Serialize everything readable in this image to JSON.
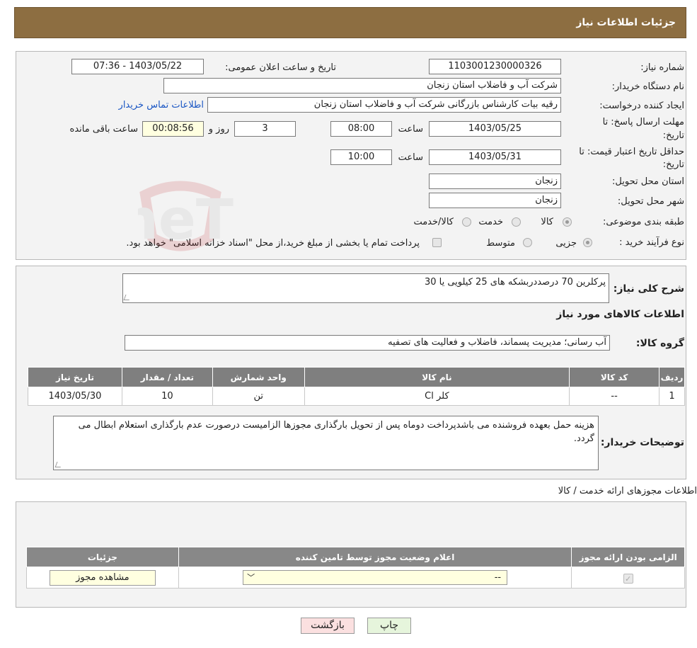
{
  "header": {
    "title": "جزئیات اطلاعات نیاز"
  },
  "form": {
    "need_number_label": "شماره نیاز:",
    "need_number": "1103001230000326",
    "announce_label": "تاریخ و ساعت اعلان عمومی:",
    "announce_value": "1403/05/22 - 07:36",
    "buyer_org_label": "نام دستگاه خریدار:",
    "buyer_org": "شرکت آب و فاضلاب استان زنجان",
    "creator_label": "ایجاد کننده درخواست:",
    "creator": "رقیه بیات کارشناس بازرگانی شرکت آب و فاضلاب استان زنجان",
    "contact_link": "اطلاعات تماس خریدار",
    "deadline_label_1": "مهلت ارسال پاسخ: تا",
    "deadline_label_2": "تاریخ:",
    "deadline_date": "1403/05/25",
    "time_label": "ساعت",
    "deadline_time": "08:00",
    "days_value": "3",
    "days_label": "روز و",
    "remaining_time": "00:08:56",
    "remaining_label": "ساعت باقی مانده",
    "validity_label_1": "حداقل تاریخ اعتبار قیمت: تا",
    "validity_label_2": "تاریخ:",
    "validity_date": "1403/05/31",
    "validity_time": "10:00",
    "province_label": "استان محل تحویل:",
    "province": "زنجان",
    "city_label": "شهر محل تحویل:",
    "city": "زنجان",
    "category_label": "طبقه بندی موضوعی:",
    "category_options": [
      "کالا",
      "خدمت",
      "کالا/خدمت"
    ],
    "purchase_label": "نوع فرآیند خرید :",
    "purchase_options": [
      "جزیی",
      "متوسط"
    ],
    "purchase_note": "پرداخت تمام یا بخشی از مبلغ خرید،از محل \"اسناد خزانه اسلامی\" خواهد بود."
  },
  "details": {
    "summary_label": "شرح کلی نیاز:",
    "summary": "پرکلرین 70 درصددربشکه های 25 کیلویی یا 30",
    "goods_title": "اطلاعات کالاهای مورد نیاز",
    "group_label": "گروه کالا:",
    "group_value": "آب رسانی؛ مدیریت پسماند، فاضلاب و فعالیت های تصفیه",
    "table_headers": [
      "ردیف",
      "کد کالا",
      "نام کالا",
      "واحد شمارش",
      "تعداد / مقدار",
      "تاریخ نیاز"
    ],
    "table_rows": [
      [
        "1",
        "--",
        "کلر Cl",
        "تن",
        "10",
        "1403/05/30"
      ]
    ],
    "buyer_notes_label": "توضیحات خریدار:",
    "buyer_notes": "هزینه حمل بعهده فروشنده می باشدپرداخت دوماه پس از تحویل بارگذاری مجوزها الزامیست درصورت عدم بارگذاری استعلام ابطال می گردد."
  },
  "permits": {
    "title": "اطلاعات مجوزهای ارائه خدمت / کالا",
    "headers": [
      "الزامی بودن ارائه مجوز",
      "اعلام وضعیت مجوز توسط تامین کننده",
      "جزئیات"
    ],
    "select_value": "--",
    "view_button": "مشاهده مجوز"
  },
  "footer": {
    "print_button": "چاپ",
    "back_button": "بازگشت"
  },
  "watermark": {
    "text": "AriaTender.neT"
  }
}
